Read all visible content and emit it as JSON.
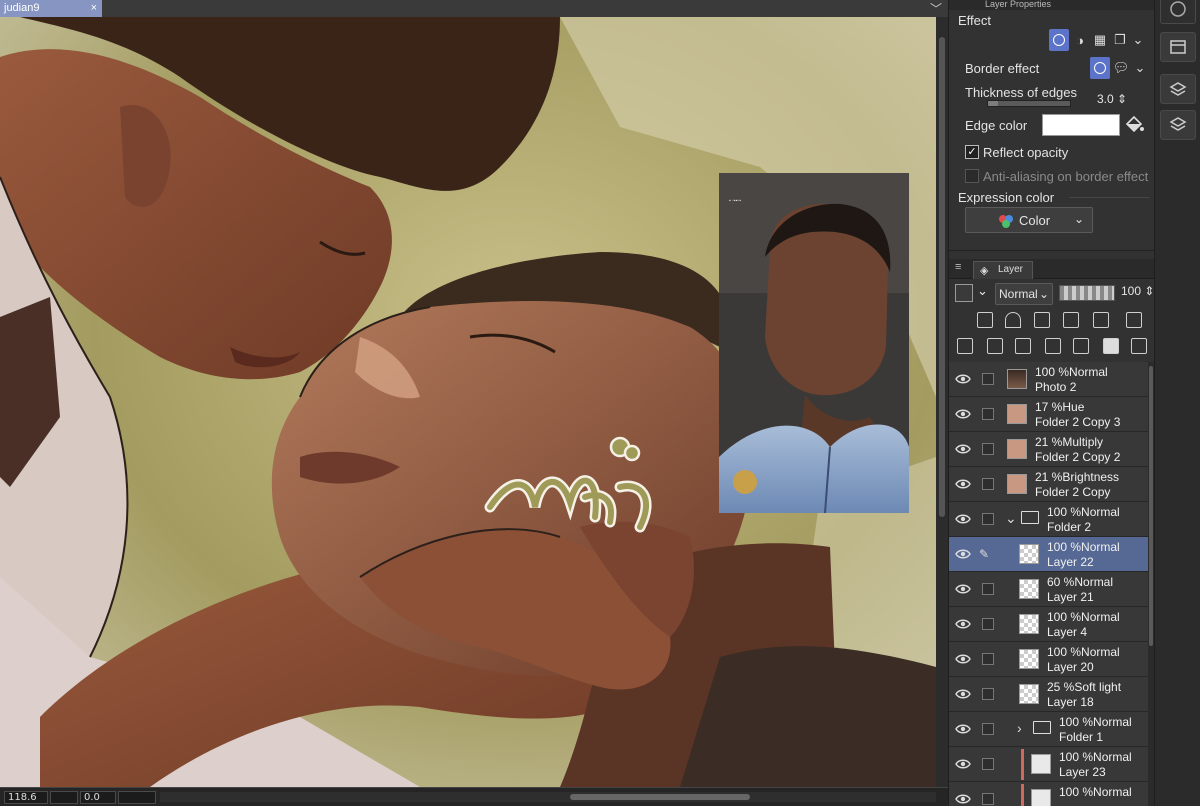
{
  "document": {
    "tab_title": "judian9",
    "close_glyph": "×",
    "tabs_menu_glyph": "﹀"
  },
  "status": {
    "zoom": "118.6",
    "rotation": "0.0"
  },
  "artwork": {
    "signature": "wip"
  },
  "layer_properties": {
    "panel_title": "Layer Properties",
    "effect_label": "Effect",
    "border_effect_label": "Border effect",
    "thickness_label": "Thickness of edges",
    "thickness_value": "3.0",
    "thickness_fraction": 0.12,
    "edge_color_label": "Edge color",
    "edge_color": "#ffffff",
    "reflect_opacity_label": "Reflect opacity",
    "reflect_opacity_checked": "✓",
    "antialias_label": "Anti-aliasing on border effect",
    "expression_color_label": "Expression color",
    "expression_color_value": "Color"
  },
  "layer_panel": {
    "tab_label": "Layer",
    "blend_mode": "Normal",
    "opacity": "100",
    "layers": [
      {
        "line1": "100 %Normal",
        "line2": "Photo 2",
        "indent": 0,
        "kind": "photo",
        "selected": false
      },
      {
        "line1": "17 %Hue",
        "line2": "Folder 2 Copy 3",
        "indent": 0,
        "kind": "fill",
        "selected": false
      },
      {
        "line1": "21 %Multiply",
        "line2": "Folder 2 Copy 2",
        "indent": 0,
        "kind": "fill",
        "selected": false
      },
      {
        "line1": "21 %Brightness",
        "line2": "Folder 2 Copy",
        "indent": 0,
        "kind": "fill",
        "selected": false
      },
      {
        "line1": "100 %Normal",
        "line2": "Folder 2",
        "indent": 0,
        "kind": "folder-open",
        "selected": false
      },
      {
        "line1": "100 %Normal",
        "line2": "Layer 22",
        "indent": 1,
        "kind": "raster",
        "selected": true
      },
      {
        "line1": "60 %Normal",
        "line2": "Layer 21",
        "indent": 1,
        "kind": "raster",
        "selected": false
      },
      {
        "line1": "100 %Normal",
        "line2": "Layer 4",
        "indent": 1,
        "kind": "raster",
        "selected": false
      },
      {
        "line1": "100 %Normal",
        "line2": "Layer 20",
        "indent": 1,
        "kind": "raster",
        "selected": false
      },
      {
        "line1": "25 %Soft light",
        "line2": "Layer 18",
        "indent": 1,
        "kind": "raster",
        "selected": false
      },
      {
        "line1": "100 %Normal",
        "line2": "Folder 1",
        "indent": 1,
        "kind": "folder-closed",
        "selected": false
      },
      {
        "line1": "100 %Normal",
        "line2": "Layer 23",
        "indent": 2,
        "kind": "raster-dark",
        "selected": false
      },
      {
        "line1": "100 %Normal",
        "line2": "",
        "indent": 2,
        "kind": "raster-dark",
        "selected": false
      }
    ]
  },
  "colors": {
    "accent": "#5b74c9",
    "selected_row": "#566894",
    "tab": "#8795c2",
    "olive_bg": "#a19a5c",
    "skin": "#8a4f36"
  }
}
